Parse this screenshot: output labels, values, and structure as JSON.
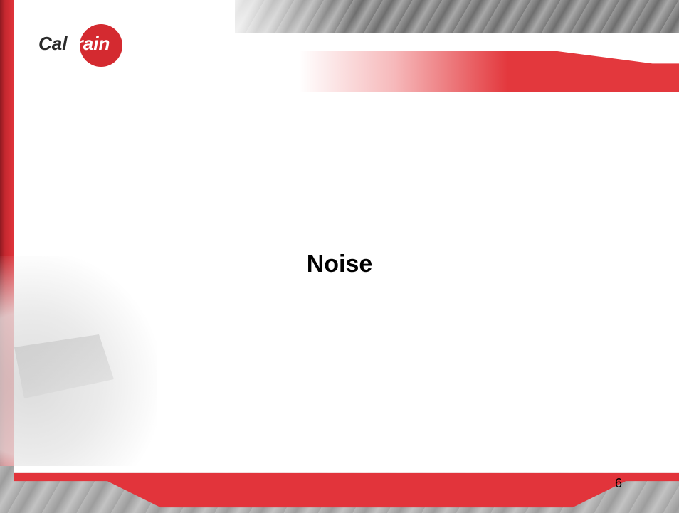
{
  "slide": {
    "title": "Noise",
    "page_number": "6"
  },
  "logo": {
    "part1": "Cal",
    "part2": "train",
    "brand_color": "#d42a30"
  },
  "colors": {
    "accent_red": "#e2343b",
    "band_gray": "#8a8a8a",
    "background": "#ffffff"
  }
}
